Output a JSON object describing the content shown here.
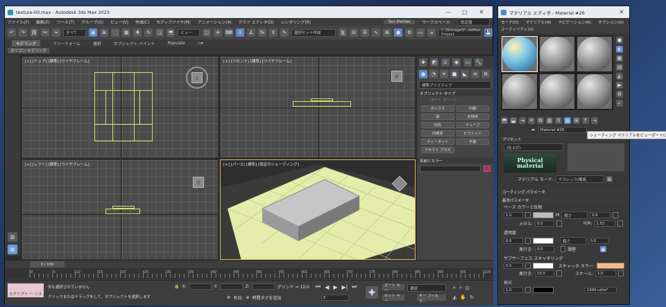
{
  "main_window": {
    "title": "texture-00.max - Autodesk 3ds Max 2023",
    "menu": [
      "ファイル(F)",
      "編集(E)",
      "ツール(T)",
      "グループ(G)",
      "ビュー(V)",
      "作成(C)",
      "モディファイヤ(M)",
      "アニメーション(A)",
      "グラフ エディタ(D)",
      "レンダリング(R)"
    ],
    "user": "Tori iPentec",
    "workspace_label": "ワークスペース:",
    "workspace_value": "既定値",
    "selection_filter": "すべて",
    "view_dropdown": "ビュー",
    "named_selection": "選択セット作成",
    "project_path": "C:\\Storage\\P...dsMax Project",
    "ribbon_tabs": [
      "モデリング",
      "フリーフォーム",
      "選択",
      "オブジェクト ペイント",
      "Populate"
    ],
    "ribbon_sub": "ポリゴン モデリング"
  },
  "viewports": {
    "top": "[+] [トップ] [標準] [ワイヤフレーム]",
    "front": "[+] [フロント] [標準] [ワイヤフレーム]",
    "left": "[+] [レフト] [標準] [ワイヤフレーム]",
    "persp": "[+] [パース] [標準] [既定のシェーディング]",
    "cube_top": "上",
    "cube_front": "前",
    "cube_left": "左"
  },
  "command_panel": {
    "category": "標準プリミティブ",
    "section_object_type": "オブジェクト タイプ",
    "autogrid": "オート グリッド",
    "buttons": [
      "ボックス",
      "円錐",
      "球",
      "天球体",
      "円柱",
      "チューブ",
      "円環体",
      "ピラミッド",
      "ティーポット",
      "平面",
      "テキスト プラス"
    ],
    "section_name_color": "名前とカラー",
    "name_color": "#c0246e"
  },
  "timeline": {
    "frame": "0 / 100",
    "ticks": [
      "0",
      "5",
      "10",
      "15",
      "20",
      "25",
      "30",
      "35",
      "40",
      "45",
      "50",
      "55",
      "60",
      "65",
      "70",
      "75",
      "80",
      "85",
      "90",
      "95",
      "100"
    ]
  },
  "status": {
    "listener": "スクリプト 一 リス",
    "msg1": "何も選択されていません",
    "msg2": "クリックまたはドラッグをして、オブジェクトを選択します",
    "x_label": "X:",
    "y_label": "Y:",
    "z_label": "Z:",
    "grid": "グリッド = 10.0",
    "enabled": "有効:",
    "add_time_tag": "時間タグを追加",
    "auto_key": "オート キー",
    "set_key": "セット キー",
    "select_label": "選択",
    "key_filter": "キー フィルタ...",
    "frame_value": "0"
  },
  "material_editor": {
    "title": "マテリアル エディタ - Material #26",
    "menu": [
      "モード(D)",
      "マテリアル(M)",
      "ナビゲーション(N)",
      "オプション(O)",
      "ユーティリティ(U)"
    ],
    "material_name": "Material #26",
    "tooltip": "シェーディング マテリアルをビューポートに表示",
    "preset_section": "プリセット",
    "preset_value": "(仕上げ)",
    "material_mode_label": "マテリアル モード:",
    "material_mode_value": "クラシック/簡易",
    "physical_label": "Physical material",
    "coating_section": "コーティング パラメータ",
    "basic_section": "基本パラメータ",
    "base_color_label": "ベース カラーと反射",
    "base_weight": "1.0",
    "roughness_label": "粗さ",
    "roughness": "0.0",
    "metalness_label": "メタル:",
    "metalness": "0.0",
    "ior_label": "IOR:",
    "ior": "1.52",
    "m_label": "M",
    "transparency_label": "透明度",
    "transp_weight": "0.0",
    "transp_rough": "0.0",
    "depth_label": "奥行き:",
    "depth": "0.0",
    "thin_label": "薄壁",
    "sss_label": "サブサーフェス スキャタリング",
    "sss_weight": "0.0",
    "scatter_color_label": "スキャッタ カラー:",
    "sss_depth_label": "奥行き:",
    "sss_depth": "10.0",
    "scale_label": "スケール:",
    "scale": "1.0",
    "emission_label": "発光",
    "emission_weight": "1.0",
    "luminance": "1500 cd/m²",
    "scatter_color": "#f7b98a"
  }
}
